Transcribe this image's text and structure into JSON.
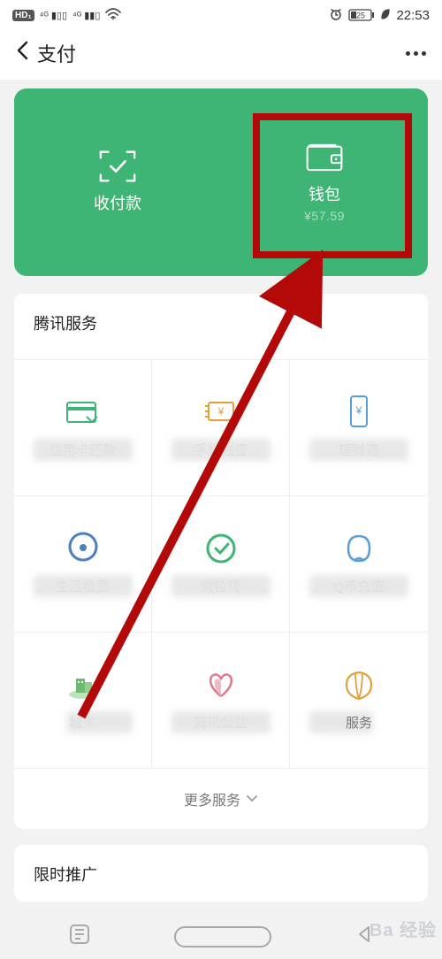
{
  "status": {
    "hd": "HD",
    "battery": "25",
    "time": "22:53"
  },
  "nav": {
    "title": "支付"
  },
  "card": {
    "pay_label": "收付款",
    "wallet_label": "钱包",
    "balance": "¥57.59"
  },
  "section1": {
    "title": "腾讯服务"
  },
  "grid": [
    {
      "label": "信用卡还款",
      "color": "#3EB575"
    },
    {
      "label": "手机充值",
      "color": "#e2a13b"
    },
    {
      "label": "理财通",
      "color": "#5a9ed8"
    },
    {
      "label": "生活缴费",
      "color": "#4b7fbf"
    },
    {
      "label": "微粒贷",
      "color": "#3EB575"
    },
    {
      "label": "Q币充值",
      "color": "#5a9ed8"
    },
    {
      "label": "城市服务",
      "color": "#6fb96f",
      "partial": "城"
    },
    {
      "label": "腾讯公益",
      "color": "#e07a8b"
    },
    {
      "label": "保险服务",
      "color": "#e2a13b",
      "partial_right": "服务"
    }
  ],
  "more_label": "更多服务",
  "section2": {
    "title": "限时推广"
  },
  "watermark": "Ba 经验"
}
